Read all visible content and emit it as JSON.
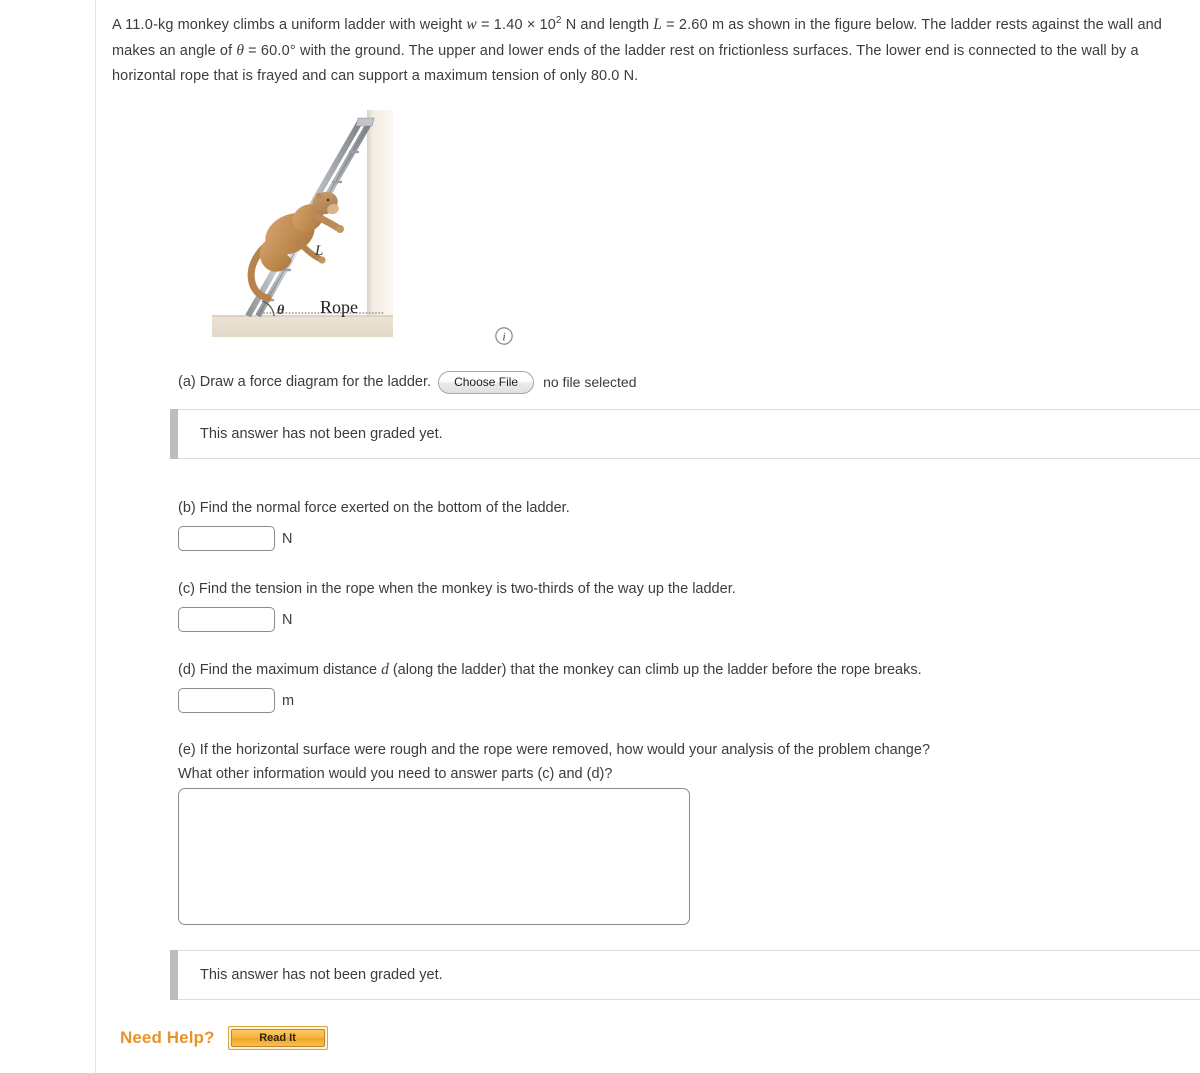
{
  "problem": {
    "line1_a": "A ",
    "mass": "11.0",
    "line1_b": "-kg monkey climbs a uniform ladder with weight ",
    "weight_symbol": "w",
    "weight_eq": " = ",
    "weight_mantissa": "1.40",
    "weight_times": " × 10",
    "weight_exponent": "2",
    "weight_unit": " N and length ",
    "length_symbol": "L",
    "length_eq": " = ",
    "length_value": "2.60",
    "line1_c": " m as shown in the figure below.",
    "line2_a": "The ladder rests against the wall and makes an angle of ",
    "theta_symbol": "θ",
    "theta_eq": " = ",
    "theta_value": "60.0°",
    "line2_b": " with the ground. The upper and lower ends of the ladder rest",
    "line3": "on frictionless surfaces. The lower end is connected to the wall by a horizontal rope that is frayed and can support a maximum",
    "line4": "tension of only 80.0 N."
  },
  "figure": {
    "label_length": "L",
    "label_angle": "θ",
    "label_rope": "Rope",
    "info_icon": "info-icon",
    "wall_color": "#efe9df",
    "ground_color": "#e7dfd2",
    "ladder_color": "#b9bcc0",
    "monkey_color": "#c79058"
  },
  "parts": {
    "a": {
      "text": "(a) Draw a force diagram for the ladder.",
      "choose_file_label": "Choose File",
      "file_status": "no file selected",
      "graded_notice": "This answer has not been graded yet."
    },
    "b": {
      "text": "(b) Find the normal force exerted on the bottom of the ladder.",
      "value": "",
      "placeholder": "",
      "unit": "N"
    },
    "c": {
      "text": "(c) Find the tension in the rope when the monkey is two-thirds of the way up the ladder.",
      "value": "",
      "placeholder": "",
      "unit": "N"
    },
    "d": {
      "text_a": "(d) Find the maximum distance ",
      "text_var": "d",
      "text_b": " (along the ladder) that the monkey can climb up the ladder before the rope breaks.",
      "value": "",
      "placeholder": "",
      "unit": "m"
    },
    "e": {
      "line1": "(e) If the horizontal surface were rough and the rope were removed, how would your analysis of the problem change?",
      "line2": "What other information would you need to answer parts (c) and (d)?",
      "value": "",
      "placeholder": "",
      "graded_notice": "This answer has not been graded yet."
    }
  },
  "footer": {
    "need_help_label": "Need Help?",
    "read_it_label": "Read It"
  },
  "colors": {
    "accent_orange": "#e8932a",
    "button_orange": "#f5b33d",
    "text": "#3c3c3c",
    "rule": "#e3e3e3"
  }
}
